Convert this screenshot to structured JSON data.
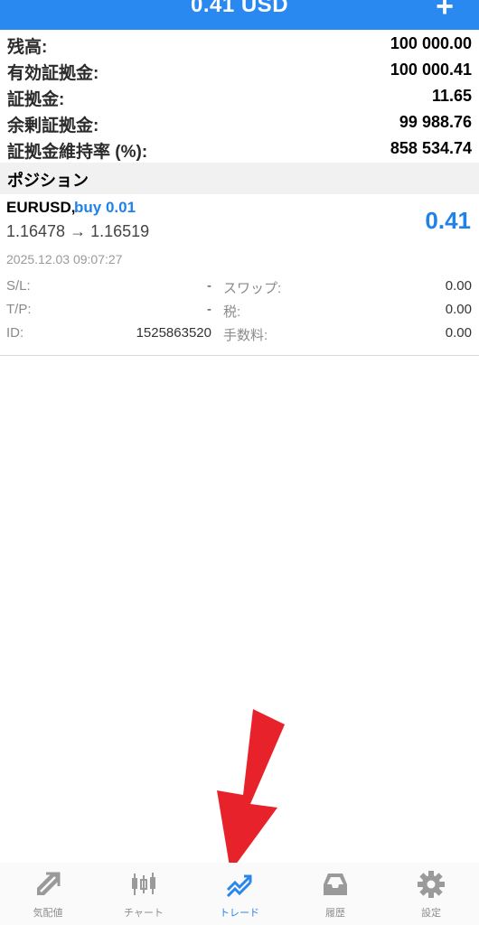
{
  "header": {
    "title": "0.41 USD",
    "add_label": "+"
  },
  "summary": [
    {
      "label": "残高:",
      "value": "100 000.00"
    },
    {
      "label": "有効証拠金:",
      "value": "100 000.41"
    },
    {
      "label": "証拠金:",
      "value": "11.65"
    },
    {
      "label": "余剰証拠金:",
      "value": "99 988.76"
    },
    {
      "label": "証拠金維持率 (%):",
      "value": "858 534.74"
    }
  ],
  "positions_header": "ポジション",
  "position": {
    "symbol": "EURUSD,",
    "side": "buy 0.01",
    "prices": "1.16478 → 1.16519",
    "profit": "0.41",
    "time": "2025.12.03 09:07:27",
    "details": [
      {
        "k1": "S/L:",
        "v1": "-",
        "k2": "スワップ:",
        "v2": "0.00"
      },
      {
        "k1": "T/P:",
        "v1": "-",
        "k2": "税:",
        "v2": "0.00"
      },
      {
        "k1": "ID:",
        "v1": "1525863520",
        "k2": "手数料:",
        "v2": "0.00"
      }
    ]
  },
  "colors": {
    "accent": "#2a89f1",
    "profit": "#1f82e8",
    "annotation_arrow": "#e8222a"
  },
  "tabs": [
    {
      "label": "気配値",
      "icon": "quotes-icon",
      "active": false
    },
    {
      "label": "チャート",
      "icon": "chart-icon",
      "active": false
    },
    {
      "label": "トレード",
      "icon": "trade-icon",
      "active": true
    },
    {
      "label": "履歴",
      "icon": "history-icon",
      "active": false
    },
    {
      "label": "設定",
      "icon": "settings-icon",
      "active": false
    }
  ]
}
